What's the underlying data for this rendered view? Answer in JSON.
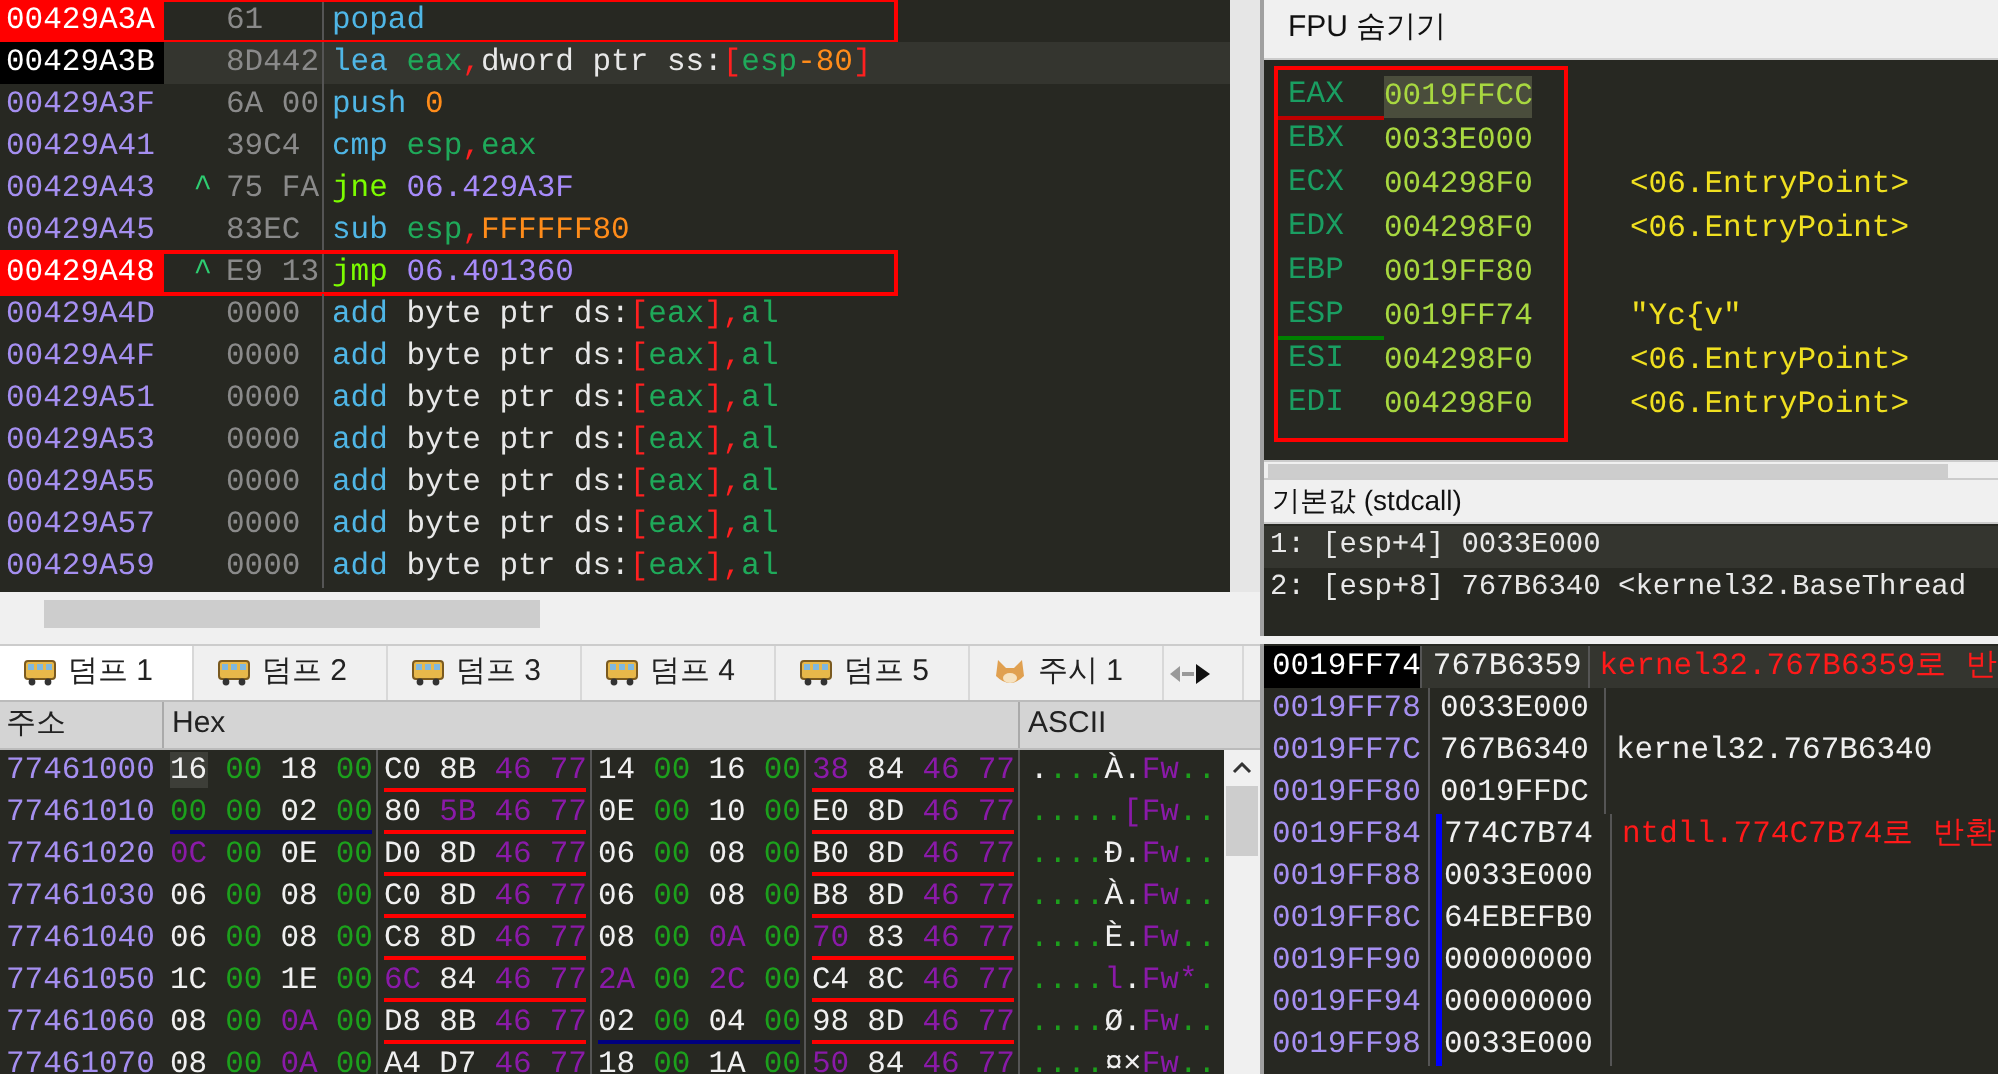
{
  "disassembly": {
    "rows": [
      {
        "address": "00429A3A",
        "bytes": "61",
        "breakpoint": true,
        "current": false,
        "annotated": true,
        "instruction": [
          {
            "kind": "mnemonic",
            "text": "popad"
          }
        ]
      },
      {
        "address": "00429A3B",
        "bytes": "8D442",
        "breakpoint": false,
        "current": true,
        "annotated": false,
        "instruction": [
          {
            "kind": "mnemonic",
            "text": "lea "
          },
          {
            "kind": "register",
            "text": "eax"
          },
          {
            "kind": "punct",
            "text": ","
          },
          {
            "kind": "plain",
            "text": "dword ptr ss:"
          },
          {
            "kind": "punct",
            "text": "["
          },
          {
            "kind": "register",
            "text": "esp"
          },
          {
            "kind": "number",
            "text": "-80"
          },
          {
            "kind": "punct",
            "text": "]"
          }
        ]
      },
      {
        "address": "00429A3F",
        "bytes": "6A 00",
        "breakpoint": false,
        "current": false,
        "annotated": false,
        "instruction": [
          {
            "kind": "mnemonic",
            "text": "push "
          },
          {
            "kind": "number",
            "text": "0"
          }
        ]
      },
      {
        "address": "00429A41",
        "bytes": "39C4",
        "breakpoint": false,
        "current": false,
        "annotated": false,
        "instruction": [
          {
            "kind": "mnemonic",
            "text": "cmp "
          },
          {
            "kind": "register",
            "text": "esp"
          },
          {
            "kind": "punct",
            "text": ","
          },
          {
            "kind": "register",
            "text": "eax"
          }
        ]
      },
      {
        "address": "00429A43",
        "arrow": "^",
        "bytes": "75 FA",
        "breakpoint": false,
        "current": false,
        "annotated": false,
        "instruction": [
          {
            "kind": "jump",
            "text": "jne "
          },
          {
            "kind": "target",
            "text": "06.429A3F"
          }
        ]
      },
      {
        "address": "00429A45",
        "bytes": "83EC",
        "breakpoint": false,
        "current": false,
        "annotated": false,
        "instruction": [
          {
            "kind": "mnemonic",
            "text": "sub "
          },
          {
            "kind": "register",
            "text": "esp"
          },
          {
            "kind": "punct",
            "text": ","
          },
          {
            "kind": "number",
            "text": "FFFFFF80"
          }
        ]
      },
      {
        "address": "00429A48",
        "arrow": "^",
        "bytes": "E9 13",
        "breakpoint": true,
        "current": false,
        "annotated": true,
        "instruction": [
          {
            "kind": "jump",
            "text": "jmp "
          },
          {
            "kind": "target",
            "text": "06.401360"
          }
        ]
      },
      {
        "address": "00429A4D",
        "bytes": "0000",
        "breakpoint": false,
        "current": false,
        "annotated": false,
        "instruction": [
          {
            "kind": "mnemonic",
            "text": "add "
          },
          {
            "kind": "plain",
            "text": "byte ptr ds:"
          },
          {
            "kind": "punct",
            "text": "["
          },
          {
            "kind": "register",
            "text": "eax"
          },
          {
            "kind": "punct",
            "text": "],"
          },
          {
            "kind": "register",
            "text": "al"
          }
        ]
      },
      {
        "address": "00429A4F",
        "bytes": "0000",
        "breakpoint": false,
        "current": false,
        "annotated": false,
        "instruction": [
          {
            "kind": "mnemonic",
            "text": "add "
          },
          {
            "kind": "plain",
            "text": "byte ptr ds:"
          },
          {
            "kind": "punct",
            "text": "["
          },
          {
            "kind": "register",
            "text": "eax"
          },
          {
            "kind": "punct",
            "text": "],"
          },
          {
            "kind": "register",
            "text": "al"
          }
        ]
      },
      {
        "address": "00429A51",
        "bytes": "0000",
        "breakpoint": false,
        "current": false,
        "annotated": false,
        "instruction": [
          {
            "kind": "mnemonic",
            "text": "add "
          },
          {
            "kind": "plain",
            "text": "byte ptr ds:"
          },
          {
            "kind": "punct",
            "text": "["
          },
          {
            "kind": "register",
            "text": "eax"
          },
          {
            "kind": "punct",
            "text": "],"
          },
          {
            "kind": "register",
            "text": "al"
          }
        ]
      },
      {
        "address": "00429A53",
        "bytes": "0000",
        "breakpoint": false,
        "current": false,
        "annotated": false,
        "instruction": [
          {
            "kind": "mnemonic",
            "text": "add "
          },
          {
            "kind": "plain",
            "text": "byte ptr ds:"
          },
          {
            "kind": "punct",
            "text": "["
          },
          {
            "kind": "register",
            "text": "eax"
          },
          {
            "kind": "punct",
            "text": "],"
          },
          {
            "kind": "register",
            "text": "al"
          }
        ]
      },
      {
        "address": "00429A55",
        "bytes": "0000",
        "breakpoint": false,
        "current": false,
        "annotated": false,
        "instruction": [
          {
            "kind": "mnemonic",
            "text": "add "
          },
          {
            "kind": "plain",
            "text": "byte ptr ds:"
          },
          {
            "kind": "punct",
            "text": "["
          },
          {
            "kind": "register",
            "text": "eax"
          },
          {
            "kind": "punct",
            "text": "],"
          },
          {
            "kind": "register",
            "text": "al"
          }
        ]
      },
      {
        "address": "00429A57",
        "bytes": "0000",
        "breakpoint": false,
        "current": false,
        "annotated": false,
        "instruction": [
          {
            "kind": "mnemonic",
            "text": "add "
          },
          {
            "kind": "plain",
            "text": "byte ptr ds:"
          },
          {
            "kind": "punct",
            "text": "["
          },
          {
            "kind": "register",
            "text": "eax"
          },
          {
            "kind": "punct",
            "text": "],"
          },
          {
            "kind": "register",
            "text": "al"
          }
        ]
      },
      {
        "address": "00429A59",
        "bytes": "0000",
        "breakpoint": false,
        "current": false,
        "annotated": false,
        "instruction": [
          {
            "kind": "mnemonic",
            "text": "add "
          },
          {
            "kind": "plain",
            "text": "byte ptr ds:"
          },
          {
            "kind": "punct",
            "text": "["
          },
          {
            "kind": "register",
            "text": "eax"
          },
          {
            "kind": "punct",
            "text": "],"
          },
          {
            "kind": "register",
            "text": "al"
          }
        ]
      }
    ]
  },
  "registers": {
    "toggle": "FPU 숨기기",
    "rows": [
      {
        "name": "EAX",
        "value": "0019FFCC",
        "color": "#c00000",
        "selected": true
      },
      {
        "name": "EBX",
        "value": "0033E000",
        "selected": false
      },
      {
        "name": "ECX",
        "value": "004298F0",
        "comment": "<06.EntryPoint>",
        "selected": false
      },
      {
        "name": "EDX",
        "value": "004298F0",
        "comment": "<06.EntryPoint>",
        "selected": false
      },
      {
        "name": "EBP",
        "value": "0019FF80",
        "selected": false
      },
      {
        "name": "ESP",
        "value": "0019FF74",
        "comment": "\"Yc{v\"",
        "color": "#008000",
        "selected": false
      },
      {
        "name": "ESI",
        "value": "004298F0",
        "comment": "<06.EntryPoint>",
        "selected": false
      },
      {
        "name": "EDI",
        "value": "004298F0",
        "comment": "<06.EntryPoint>",
        "selected": false
      }
    ]
  },
  "arguments": {
    "title": "기본값 (stdcall)",
    "rows": [
      "1: [esp+4] 0033E000",
      "2: [esp+8] 767B6340 <kernel32.BaseThread"
    ]
  },
  "dump_tabs": [
    {
      "label": "덤프 1",
      "kind": "dump",
      "selected": true
    },
    {
      "label": "덤프 2",
      "kind": "dump",
      "selected": false
    },
    {
      "label": "덤프 3",
      "kind": "dump",
      "selected": false
    },
    {
      "label": "덤프 4",
      "kind": "dump",
      "selected": false
    },
    {
      "label": "덤프 5",
      "kind": "dump",
      "selected": false
    },
    {
      "label": "주시 1",
      "kind": "watch",
      "selected": false
    },
    {
      "kind": "more",
      "selected": false
    }
  ],
  "dump": {
    "columns": [
      "주소",
      "Hex",
      "ASCII"
    ],
    "rows": [
      {
        "address": "77461000",
        "groups": [
          {
            "bytes": [
              {
                "kind": "plain",
                "text": "16"
              },
              {
                "kind": "zero",
                "text": "00"
              },
              {
                "kind": "plain",
                "text": "18"
              },
              {
                "kind": "zero",
                "text": "00"
              }
            ]
          },
          {
            "color": "#ff0000",
            "bytes": [
              {
                "kind": "plain",
                "text": "C0"
              },
              {
                "kind": "plain",
                "text": "8B"
              },
              {
                "kind": "mark",
                "text": "46"
              },
              {
                "kind": "mark",
                "text": "77"
              }
            ]
          },
          {
            "bytes": [
              {
                "kind": "plain",
                "text": "14"
              },
              {
                "kind": "zero",
                "text": "00"
              },
              {
                "kind": "plain",
                "text": "16"
              },
              {
                "kind": "zero",
                "text": "00"
              }
            ]
          },
          {
            "color": "#ff0000",
            "bytes": [
              {
                "kind": "mark",
                "text": "38"
              },
              {
                "kind": "plain",
                "text": "84"
              },
              {
                "kind": "mark",
                "text": "46"
              },
              {
                "kind": "mark",
                "text": "77"
              }
            ]
          }
        ],
        "ascii": [
          {
            "kind": "plain",
            "text": "."
          },
          {
            "kind": "zero",
            "text": "..."
          },
          {
            "kind": "plain",
            "text": "À."
          },
          {
            "kind": "mark",
            "text": "Fw"
          },
          {
            "kind": "zero",
            "text": ".."
          }
        ]
      },
      {
        "address": "77461010",
        "groups": [
          {
            "color": "#000080",
            "bytes": [
              {
                "kind": "zero",
                "text": "00"
              },
              {
                "kind": "zero",
                "text": "00"
              },
              {
                "kind": "plain",
                "text": "02"
              },
              {
                "kind": "zero",
                "text": "00"
              }
            ]
          },
          {
            "color": "#ff0000",
            "bytes": [
              {
                "kind": "plain",
                "text": "80"
              },
              {
                "kind": "mark",
                "text": "5B"
              },
              {
                "kind": "mark",
                "text": "46"
              },
              {
                "kind": "mark",
                "text": "77"
              }
            ]
          },
          {
            "bytes": [
              {
                "kind": "plain",
                "text": "0E"
              },
              {
                "kind": "zero",
                "text": "00"
              },
              {
                "kind": "plain",
                "text": "10"
              },
              {
                "kind": "zero",
                "text": "00"
              }
            ]
          },
          {
            "color": "#ff0000",
            "bytes": [
              {
                "kind": "plain",
                "text": "E0"
              },
              {
                "kind": "plain",
                "text": "8D"
              },
              {
                "kind": "mark",
                "text": "46"
              },
              {
                "kind": "mark",
                "text": "77"
              }
            ]
          }
        ],
        "ascii": [
          {
            "kind": "zero",
            "text": "....."
          },
          {
            "kind": "mark",
            "text": "[Fw"
          },
          {
            "kind": "zero",
            "text": ".."
          }
        ]
      },
      {
        "address": "77461020",
        "groups": [
          {
            "bytes": [
              {
                "kind": "mark",
                "text": "0C"
              },
              {
                "kind": "zero",
                "text": "00"
              },
              {
                "kind": "plain",
                "text": "0E"
              },
              {
                "kind": "zero",
                "text": "00"
              }
            ]
          },
          {
            "color": "#ff0000",
            "bytes": [
              {
                "kind": "plain",
                "text": "D0"
              },
              {
                "kind": "plain",
                "text": "8D"
              },
              {
                "kind": "mark",
                "text": "46"
              },
              {
                "kind": "mark",
                "text": "77"
              }
            ]
          },
          {
            "bytes": [
              {
                "kind": "plain",
                "text": "06"
              },
              {
                "kind": "zero",
                "text": "00"
              },
              {
                "kind": "plain",
                "text": "08"
              },
              {
                "kind": "zero",
                "text": "00"
              }
            ]
          },
          {
            "color": "#ff0000",
            "bytes": [
              {
                "kind": "plain",
                "text": "B0"
              },
              {
                "kind": "plain",
                "text": "8D"
              },
              {
                "kind": "mark",
                "text": "46"
              },
              {
                "kind": "mark",
                "text": "77"
              }
            ]
          }
        ],
        "ascii": [
          {
            "kind": "zero",
            "text": "...."
          },
          {
            "kind": "plain",
            "text": "Đ."
          },
          {
            "kind": "mark",
            "text": "Fw"
          },
          {
            "kind": "zero",
            "text": ".."
          }
        ]
      },
      {
        "address": "77461030",
        "groups": [
          {
            "bytes": [
              {
                "kind": "plain",
                "text": "06"
              },
              {
                "kind": "zero",
                "text": "00"
              },
              {
                "kind": "plain",
                "text": "08"
              },
              {
                "kind": "zero",
                "text": "00"
              }
            ]
          },
          {
            "color": "#ff0000",
            "bytes": [
              {
                "kind": "plain",
                "text": "C0"
              },
              {
                "kind": "plain",
                "text": "8D"
              },
              {
                "kind": "mark",
                "text": "46"
              },
              {
                "kind": "mark",
                "text": "77"
              }
            ]
          },
          {
            "bytes": [
              {
                "kind": "plain",
                "text": "06"
              },
              {
                "kind": "zero",
                "text": "00"
              },
              {
                "kind": "plain",
                "text": "08"
              },
              {
                "kind": "zero",
                "text": "00"
              }
            ]
          },
          {
            "color": "#ff0000",
            "bytes": [
              {
                "kind": "plain",
                "text": "B8"
              },
              {
                "kind": "plain",
                "text": "8D"
              },
              {
                "kind": "mark",
                "text": "46"
              },
              {
                "kind": "mark",
                "text": "77"
              }
            ]
          }
        ],
        "ascii": [
          {
            "kind": "zero",
            "text": "...."
          },
          {
            "kind": "plain",
            "text": "À."
          },
          {
            "kind": "mark",
            "text": "Fw"
          },
          {
            "kind": "zero",
            "text": ".."
          }
        ]
      },
      {
        "address": "77461040",
        "groups": [
          {
            "bytes": [
              {
                "kind": "plain",
                "text": "06"
              },
              {
                "kind": "zero",
                "text": "00"
              },
              {
                "kind": "plain",
                "text": "08"
              },
              {
                "kind": "zero",
                "text": "00"
              }
            ]
          },
          {
            "color": "#ff0000",
            "bytes": [
              {
                "kind": "plain",
                "text": "C8"
              },
              {
                "kind": "plain",
                "text": "8D"
              },
              {
                "kind": "mark",
                "text": "46"
              },
              {
                "kind": "mark",
                "text": "77"
              }
            ]
          },
          {
            "bytes": [
              {
                "kind": "plain",
                "text": "08"
              },
              {
                "kind": "zero",
                "text": "00"
              },
              {
                "kind": "mark",
                "text": "0A"
              },
              {
                "kind": "zero",
                "text": "00"
              }
            ]
          },
          {
            "color": "#ff0000",
            "bytes": [
              {
                "kind": "mark",
                "text": "70"
              },
              {
                "kind": "plain",
                "text": "83"
              },
              {
                "kind": "mark",
                "text": "46"
              },
              {
                "kind": "mark",
                "text": "77"
              }
            ]
          }
        ],
        "ascii": [
          {
            "kind": "zero",
            "text": "...."
          },
          {
            "kind": "plain",
            "text": "È."
          },
          {
            "kind": "mark",
            "text": "Fw"
          },
          {
            "kind": "zero",
            "text": ".."
          }
        ]
      },
      {
        "address": "77461050",
        "groups": [
          {
            "bytes": [
              {
                "kind": "plain",
                "text": "1C"
              },
              {
                "kind": "zero",
                "text": "00"
              },
              {
                "kind": "plain",
                "text": "1E"
              },
              {
                "kind": "zero",
                "text": "00"
              }
            ]
          },
          {
            "color": "#ff0000",
            "bytes": [
              {
                "kind": "mark",
                "text": "6C"
              },
              {
                "kind": "plain",
                "text": "84"
              },
              {
                "kind": "mark",
                "text": "46"
              },
              {
                "kind": "mark",
                "text": "77"
              }
            ]
          },
          {
            "bytes": [
              {
                "kind": "mark",
                "text": "2A"
              },
              {
                "kind": "zero",
                "text": "00"
              },
              {
                "kind": "mark",
                "text": "2C"
              },
              {
                "kind": "zero",
                "text": "00"
              }
            ]
          },
          {
            "color": "#ff0000",
            "bytes": [
              {
                "kind": "plain",
                "text": "C4"
              },
              {
                "kind": "plain",
                "text": "8C"
              },
              {
                "kind": "mark",
                "text": "46"
              },
              {
                "kind": "mark",
                "text": "77"
              }
            ]
          }
        ],
        "ascii": [
          {
            "kind": "zero",
            "text": "...."
          },
          {
            "kind": "mark",
            "text": "l"
          },
          {
            "kind": "plain",
            "text": "."
          },
          {
            "kind": "mark",
            "text": "Fw*"
          },
          {
            "kind": "zero",
            "text": "."
          }
        ]
      },
      {
        "address": "77461060",
        "groups": [
          {
            "bytes": [
              {
                "kind": "plain",
                "text": "08"
              },
              {
                "kind": "zero",
                "text": "00"
              },
              {
                "kind": "mark",
                "text": "0A"
              },
              {
                "kind": "zero",
                "text": "00"
              }
            ]
          },
          {
            "color": "#ff0000",
            "bytes": [
              {
                "kind": "plain",
                "text": "D8"
              },
              {
                "kind": "plain",
                "text": "8B"
              },
              {
                "kind": "mark",
                "text": "46"
              },
              {
                "kind": "mark",
                "text": "77"
              }
            ]
          },
          {
            "color": "#000080",
            "bytes": [
              {
                "kind": "plain",
                "text": "02"
              },
              {
                "kind": "zero",
                "text": "00"
              },
              {
                "kind": "plain",
                "text": "04"
              },
              {
                "kind": "zero",
                "text": "00"
              }
            ]
          },
          {
            "color": "#ff0000",
            "bytes": [
              {
                "kind": "plain",
                "text": "98"
              },
              {
                "kind": "plain",
                "text": "8D"
              },
              {
                "kind": "mark",
                "text": "46"
              },
              {
                "kind": "mark",
                "text": "77"
              }
            ]
          }
        ],
        "ascii": [
          {
            "kind": "zero",
            "text": "...."
          },
          {
            "kind": "plain",
            "text": "Ø."
          },
          {
            "kind": "mark",
            "text": "Fw"
          },
          {
            "kind": "zero",
            "text": ".."
          }
        ]
      },
      {
        "address": "77461070",
        "groups": [
          {
            "bytes": [
              {
                "kind": "plain",
                "text": "08"
              },
              {
                "kind": "zero",
                "text": "00"
              },
              {
                "kind": "mark",
                "text": "0A"
              },
              {
                "kind": "zero",
                "text": "00"
              }
            ]
          },
          {
            "bytes": [
              {
                "kind": "plain",
                "text": "A4"
              },
              {
                "kind": "plain",
                "text": "D7"
              },
              {
                "kind": "mark",
                "text": "46"
              },
              {
                "kind": "mark",
                "text": "77"
              }
            ]
          },
          {
            "bytes": [
              {
                "kind": "plain",
                "text": "18"
              },
              {
                "kind": "zero",
                "text": "00"
              },
              {
                "kind": "plain",
                "text": "1A"
              },
              {
                "kind": "zero",
                "text": "00"
              }
            ]
          },
          {
            "bytes": [
              {
                "kind": "mark",
                "text": "50"
              },
              {
                "kind": "plain",
                "text": "84"
              },
              {
                "kind": "mark",
                "text": "46"
              },
              {
                "kind": "mark",
                "text": "77"
              }
            ]
          }
        ],
        "ascii": [
          {
            "kind": "zero",
            "text": "...."
          },
          {
            "kind": "plain",
            "text": "¤×"
          },
          {
            "kind": "mark",
            "text": "Fw"
          },
          {
            "kind": "zero",
            "text": ".."
          }
        ]
      }
    ]
  },
  "stack": {
    "rows": [
      {
        "address": "0019FF74",
        "value": "767B6359",
        "comment": "kernel32.767B6359로 반",
        "kind": "return",
        "current": true,
        "bracket": false
      },
      {
        "address": "0019FF78",
        "value": "0033E000",
        "current": false,
        "bracket": false
      },
      {
        "address": "0019FF7C",
        "value": "767B6340",
        "comment": "kernel32.767B6340",
        "kind": "plain",
        "current": false,
        "bracket": false
      },
      {
        "address": "0019FF80",
        "value": "0019FFDC",
        "current": false,
        "bracket": false
      },
      {
        "address": "0019FF84",
        "value": "774C7B74",
        "comment": "ntdll.774C7B74로 반환",
        "kind": "return",
        "current": false,
        "bracket": true
      },
      {
        "address": "0019FF88",
        "value": "0033E000",
        "current": false,
        "bracket": true
      },
      {
        "address": "0019FF8C",
        "value": "64EBEFB0",
        "current": false,
        "bracket": true
      },
      {
        "address": "0019FF90",
        "value": "00000000",
        "current": false,
        "bracket": true
      },
      {
        "address": "0019FF94",
        "value": "00000000",
        "current": false,
        "bracket": true
      },
      {
        "address": "0019FF98",
        "value": "0033E000",
        "current": false,
        "bracket": true
      }
    ]
  }
}
